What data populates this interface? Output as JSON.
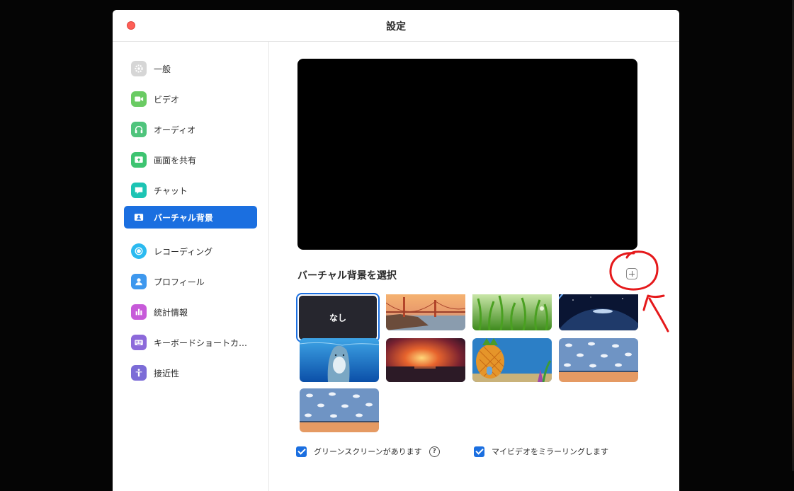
{
  "window": {
    "title": "設定"
  },
  "sidebar": {
    "items": [
      {
        "label": "一般",
        "icon": "gear-icon",
        "color": "#d0d0d0"
      },
      {
        "label": "ビデオ",
        "icon": "video-camera-icon",
        "color": "#5fc760"
      },
      {
        "label": "オーディオ",
        "icon": "headphones-icon",
        "color": "#4cc37a"
      },
      {
        "label": "画面を共有",
        "icon": "share-screen-icon",
        "color": "#3cc46f"
      },
      {
        "label": "チャット",
        "icon": "chat-bubble-icon",
        "color": "#19c3b3"
      },
      {
        "label": "バーチャル背景",
        "icon": "virtual-background-icon",
        "color": "#1b6fe0",
        "active": true
      },
      {
        "label": "レコーディング",
        "icon": "record-icon",
        "color": "#2cb9f0"
      },
      {
        "label": "プロフィール",
        "icon": "profile-icon",
        "color": "#3d97ee"
      },
      {
        "label": "統計情報",
        "icon": "statistics-icon",
        "color": "#c457d9"
      },
      {
        "label": "キーボードショートカ…",
        "icon": "keyboard-icon",
        "color": "#8a67d9"
      },
      {
        "label": "接近性",
        "icon": "accessibility-icon",
        "color": "#7a6ad6"
      }
    ]
  },
  "main": {
    "section_title": "バーチャル背景を選択",
    "add_button_icon": "plus-icon",
    "backgrounds": [
      {
        "label": "なし",
        "type": "none",
        "selected": true
      },
      {
        "type": "golden-gate-bridge-image"
      },
      {
        "type": "grass-image"
      },
      {
        "type": "earth-from-space-image"
      },
      {
        "type": "dolphin-image"
      },
      {
        "type": "sunset-sea-image"
      },
      {
        "type": "pineapple-house-image"
      },
      {
        "type": "cloud-wallpaper-room-image"
      },
      {
        "type": "cloud-wallpaper-room-image"
      }
    ],
    "green_screen": {
      "label": "グリーンスクリーンがあります",
      "checked": true,
      "help_icon": "?"
    },
    "mirror_video": {
      "label": "マイビデオをミラーリングします",
      "checked": true
    }
  },
  "annotation": {
    "color": "#e5191b",
    "shape": "red-circle-and-arrow"
  }
}
